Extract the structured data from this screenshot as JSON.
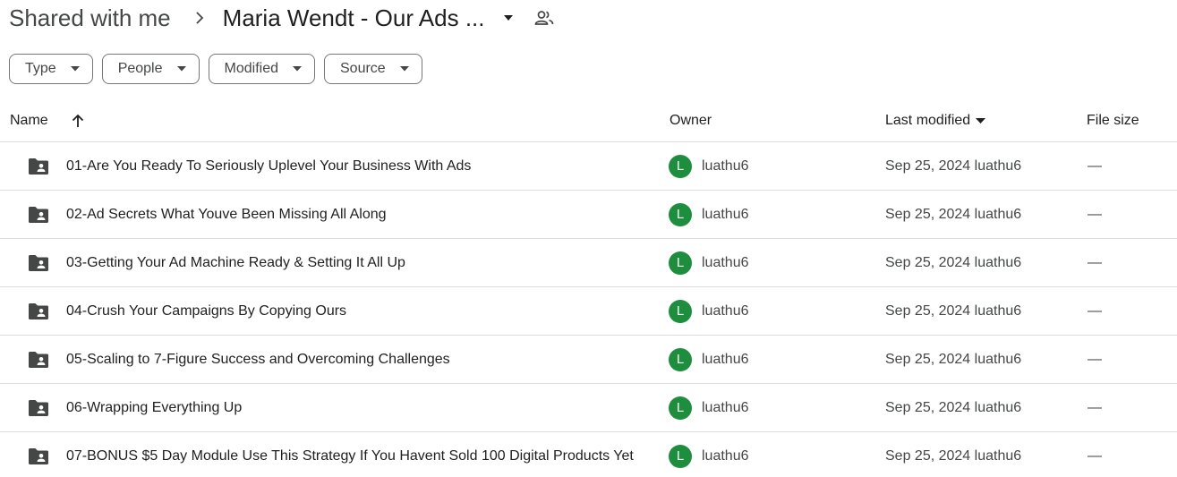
{
  "breadcrumb": {
    "root": "Shared with me",
    "current": "Maria Wendt - Our Ads ..."
  },
  "filters": [
    {
      "label": "Type"
    },
    {
      "label": "People"
    },
    {
      "label": "Modified"
    },
    {
      "label": "Source"
    }
  ],
  "columns": {
    "name": "Name",
    "owner": "Owner",
    "last_modified": "Last modified",
    "file_size": "File size"
  },
  "rows": [
    {
      "name": "01-Are You Ready To Seriously Uplevel Your Business With Ads",
      "owner_initial": "L",
      "owner": "luathu6",
      "modified": "Sep 25, 2024 luathu6",
      "size": "—"
    },
    {
      "name": "02-Ad Secrets What Youve Been Missing All Along",
      "owner_initial": "L",
      "owner": "luathu6",
      "modified": "Sep 25, 2024 luathu6",
      "size": "—"
    },
    {
      "name": "03-Getting Your Ad Machine Ready & Setting It All Up",
      "owner_initial": "L",
      "owner": "luathu6",
      "modified": "Sep 25, 2024 luathu6",
      "size": "—"
    },
    {
      "name": "04-Crush Your Campaigns By Copying Ours",
      "owner_initial": "L",
      "owner": "luathu6",
      "modified": "Sep 25, 2024 luathu6",
      "size": "—"
    },
    {
      "name": "05-Scaling to 7-Figure Success and Overcoming Challenges",
      "owner_initial": "L",
      "owner": "luathu6",
      "modified": "Sep 25, 2024 luathu6",
      "size": "—"
    },
    {
      "name": "06-Wrapping Everything Up",
      "owner_initial": "L",
      "owner": "luathu6",
      "modified": "Sep 25, 2024 luathu6",
      "size": "—"
    },
    {
      "name": "07-BONUS $5 Day Module Use This Strategy If You Havent Sold 100 Digital Products Yet",
      "owner_initial": "L",
      "owner": "luathu6",
      "modified": "Sep 25, 2024 luathu6",
      "size": "—"
    }
  ],
  "icons": {
    "separator": "chevron-right-icon",
    "folder_menu": "caret-down-icon",
    "shared": "shared-people-icon",
    "sort_asc": "arrow-up-icon",
    "sort_desc": "caret-down-icon",
    "row": "shared-folder-icon"
  },
  "colors": {
    "avatar": "#1e8e3e",
    "divider": "#dadce0",
    "text": "#1f1f1f",
    "secondary_text": "#444746"
  }
}
